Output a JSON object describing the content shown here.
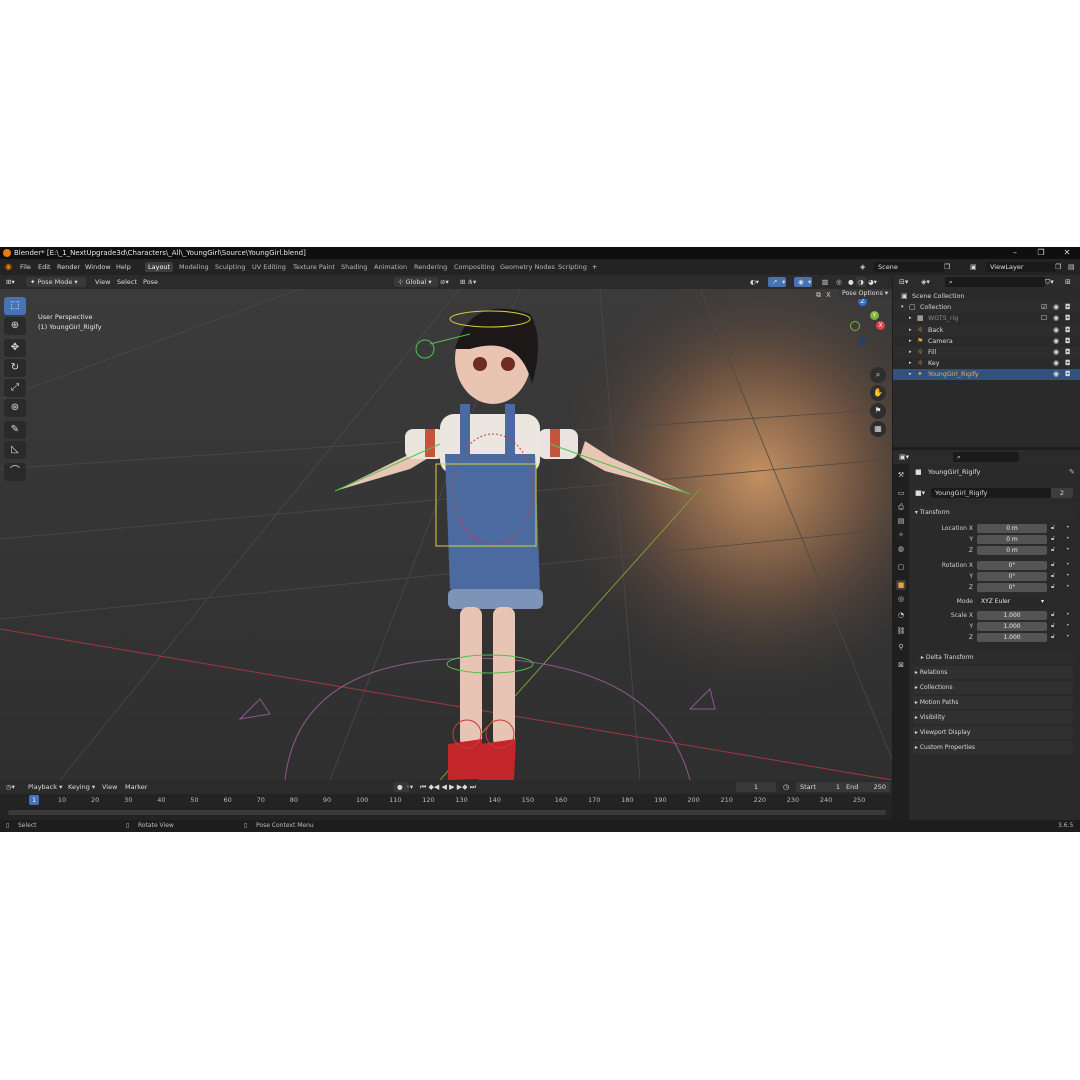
{
  "window": {
    "title": "Blender* [E:\\_1_NextUpgrade3d\\Characters\\_All\\_YoungGirl\\Source\\YoungGirl.blend]",
    "minimize": "–",
    "maximize": "❐",
    "close": "✕"
  },
  "menu": [
    "File",
    "Edit",
    "Render",
    "Window",
    "Help"
  ],
  "workspaces": [
    "Layout",
    "Modeling",
    "Sculpting",
    "UV Editing",
    "Texture Paint",
    "Shading",
    "Animation",
    "Rendering",
    "Compositing",
    "Geometry Nodes",
    "Scripting"
  ],
  "add_workspace": "+",
  "scene_field": "Scene",
  "view_layer_field": "ViewLayer",
  "viewport_header": {
    "mode": "Pose Mode",
    "menus": [
      "View",
      "Select",
      "Pose"
    ],
    "transform_orientation": "Global",
    "pose_options": "Pose Options",
    "x_toggle": "X"
  },
  "viewport": {
    "perspective_label": "User Perspective",
    "object_label": "(1) YoungGirl_Rigify",
    "gizmo": {
      "x": "X",
      "y": "Y",
      "z": "Z"
    }
  },
  "timeline": {
    "menus": [
      "Playback",
      "Keying",
      "View",
      "Marker"
    ],
    "current_frame": "1",
    "start_label": "Start",
    "start": "1",
    "end_label": "End",
    "end": "250",
    "ruler": [
      "1",
      "10",
      "20",
      "30",
      "40",
      "50",
      "60",
      "70",
      "80",
      "90",
      "100",
      "110",
      "120",
      "130",
      "140",
      "150",
      "160",
      "170",
      "180",
      "190",
      "200",
      "210",
      "220",
      "230",
      "240",
      "250"
    ]
  },
  "status_bar": {
    "select": "Select",
    "rotate": "Rotate View",
    "context": "Pose Context Menu",
    "version": "3.6.5"
  },
  "outliner": {
    "rows": [
      {
        "label": "Scene Collection",
        "indent": 0
      },
      {
        "label": "Collection",
        "indent": 1
      },
      {
        "label": "WGTS_rig",
        "indent": 2
      },
      {
        "label": "Back",
        "indent": 2
      },
      {
        "label": "Camera",
        "indent": 2
      },
      {
        "label": "Fill",
        "indent": 2
      },
      {
        "label": "Key",
        "indent": 2
      },
      {
        "label": "YoungGirl_Rigify",
        "indent": 2
      }
    ]
  },
  "properties": {
    "object_name": "YoungGirl_Rigify",
    "data_name": "YoungGirl_Rigify",
    "users": "2",
    "transform_header": "Transform",
    "location_label": "Location X",
    "rotation_label": "Rotation X",
    "scale_label": "Scale X",
    "y_label": "Y",
    "z_label": "Z",
    "mode_label": "Mode",
    "location": [
      "0 m",
      "0 m",
      "0 m"
    ],
    "rotation": [
      "0°",
      "0°",
      "0°"
    ],
    "mode": "XYZ Euler",
    "scale": [
      "1.000",
      "1.000",
      "1.000"
    ],
    "panels": [
      "Delta Transform",
      "Relations",
      "Collections",
      "Motion Paths",
      "Visibility",
      "Viewport Display",
      "Custom Properties"
    ]
  },
  "colors": {
    "accent": "#4772b3",
    "selected_row": "#33517e",
    "active_object": "#e8a33b"
  }
}
